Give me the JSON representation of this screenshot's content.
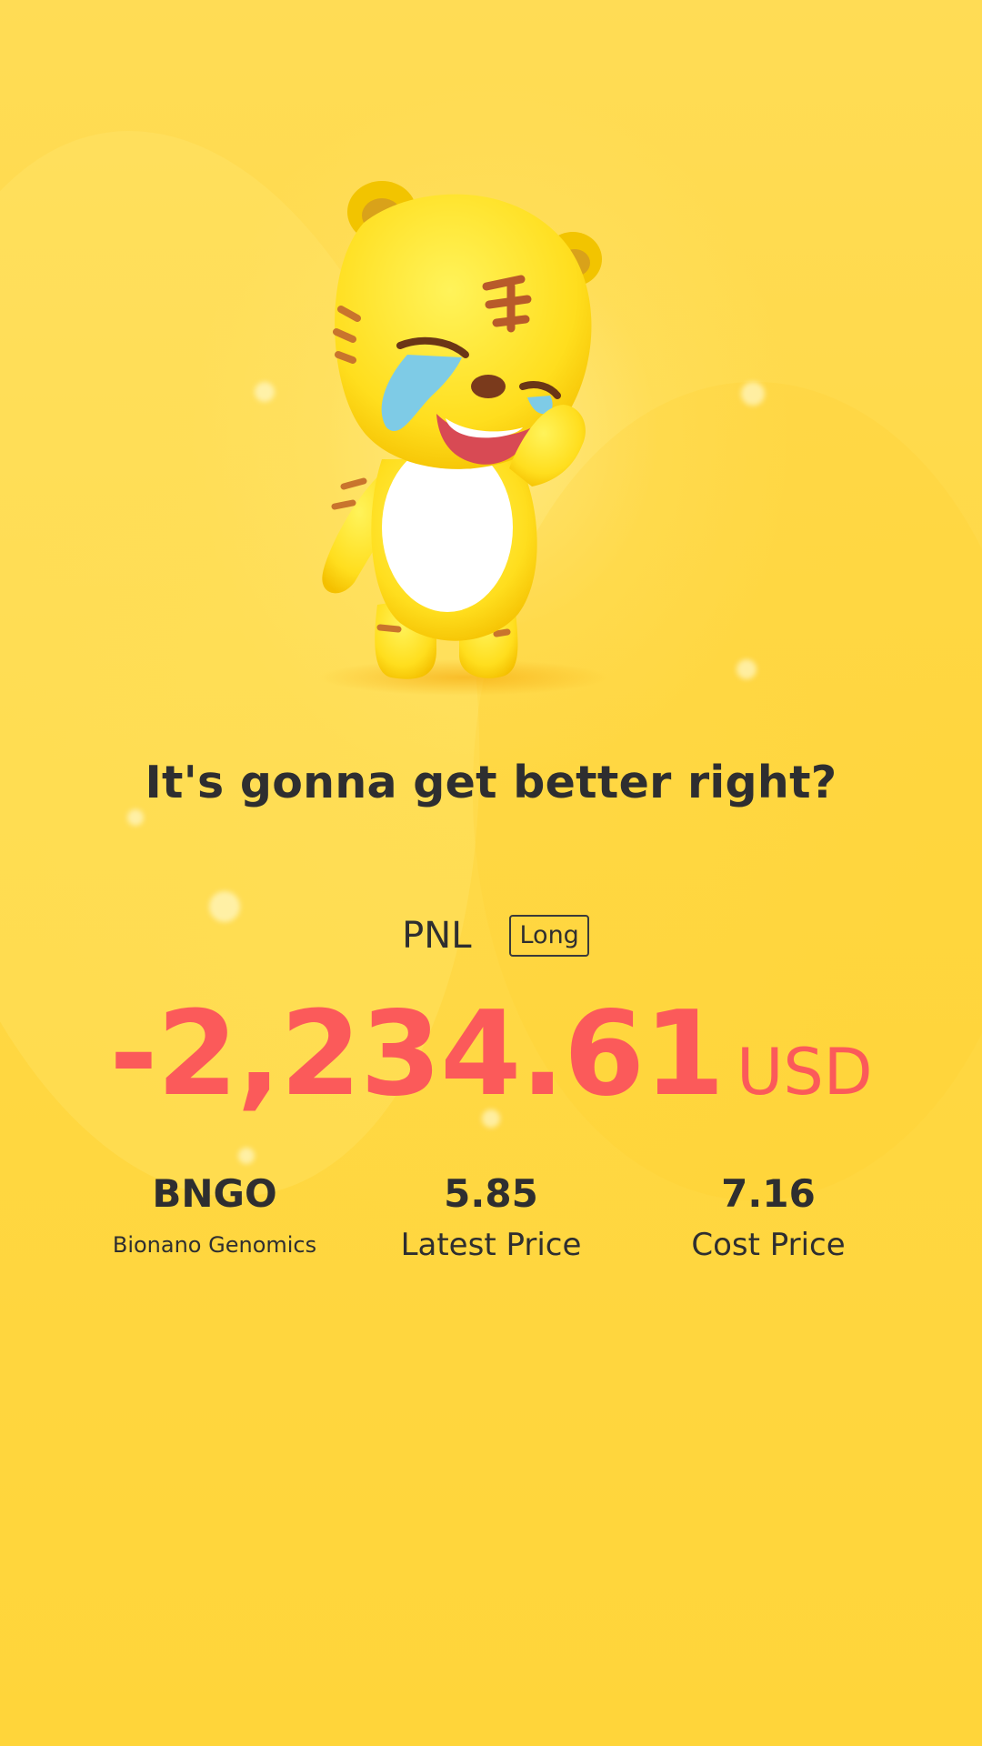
{
  "headline": "It's gonna get better right?",
  "pnl": {
    "label": "PNL",
    "side_badge": "Long",
    "amount": "-2,234.61",
    "currency": "USD",
    "amount_color": "#fb5a5a"
  },
  "stock": {
    "symbol": "BNGO",
    "name": "Bionano Genomics"
  },
  "latest_price": {
    "value": "5.85",
    "label": "Latest Price"
  },
  "cost_price": {
    "value": "7.16",
    "label": "Cost Price"
  },
  "colors": {
    "background": "#ffd844",
    "text": "#2e2e30",
    "loss": "#fb5a5a"
  },
  "mascot": "crying-tiger-mascot"
}
